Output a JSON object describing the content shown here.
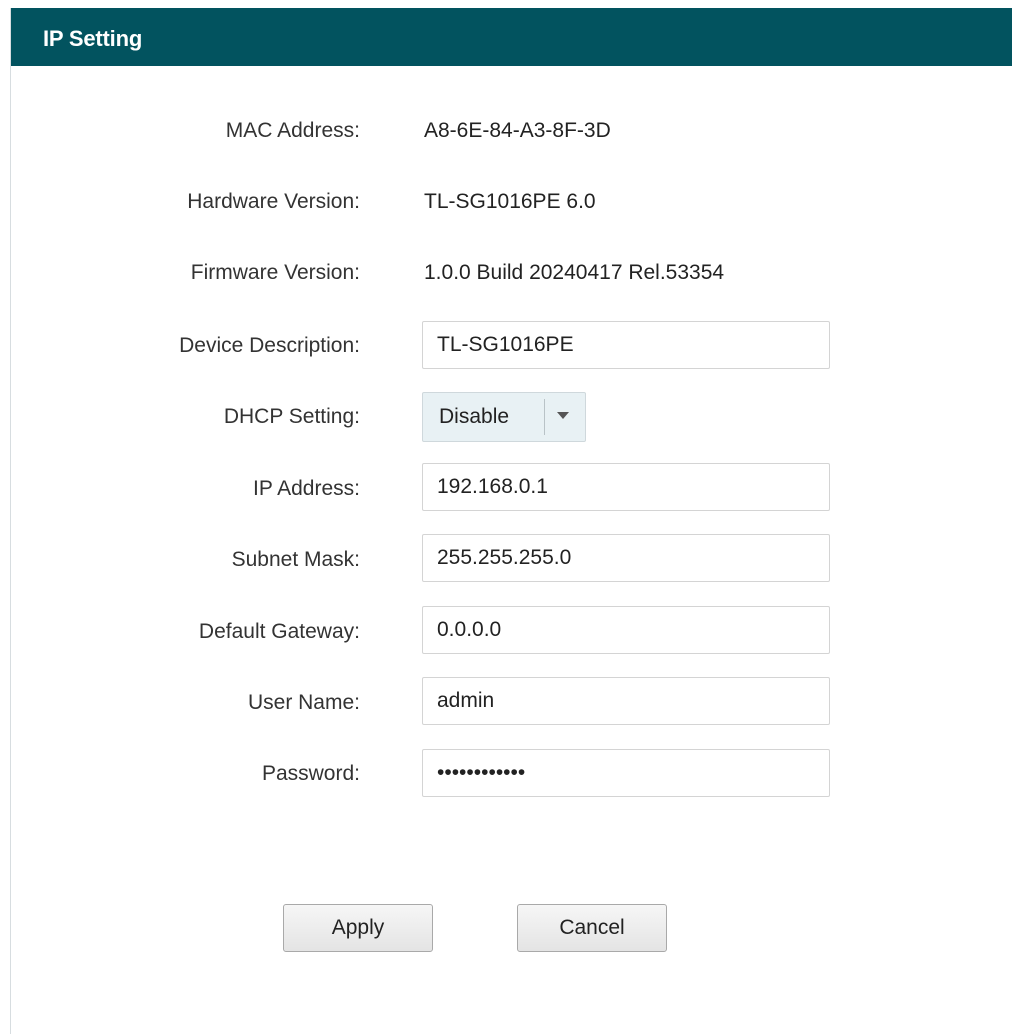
{
  "header": {
    "title": "IP Setting"
  },
  "info": {
    "mac_label": "MAC Address:",
    "mac_value": "A8-6E-84-A3-8F-3D",
    "hardware_label": "Hardware Version:",
    "hardware_value": "TL-SG1016PE 6.0",
    "firmware_label": "Firmware Version:",
    "firmware_value": "1.0.0 Build 20240417 Rel.53354"
  },
  "form": {
    "description_label": "Device Description:",
    "description_value": "TL-SG1016PE",
    "dhcp_label": "DHCP Setting:",
    "dhcp_value": "Disable",
    "ip_label": "IP Address:",
    "ip_value": "192.168.0.1",
    "subnet_label": "Subnet Mask:",
    "subnet_value": "255.255.255.0",
    "gateway_label": "Default Gateway:",
    "gateway_value": "0.0.0.0",
    "username_label": "User Name:",
    "username_value": "admin",
    "password_label": "Password:",
    "password_value": "••••••••••••"
  },
  "buttons": {
    "apply": "Apply",
    "cancel": "Cancel"
  },
  "icons": {
    "dhcp_dropdown": "chevron-down-icon"
  },
  "colors": {
    "header_bg": "#02535f",
    "select_bg": "#e8f1f4"
  }
}
